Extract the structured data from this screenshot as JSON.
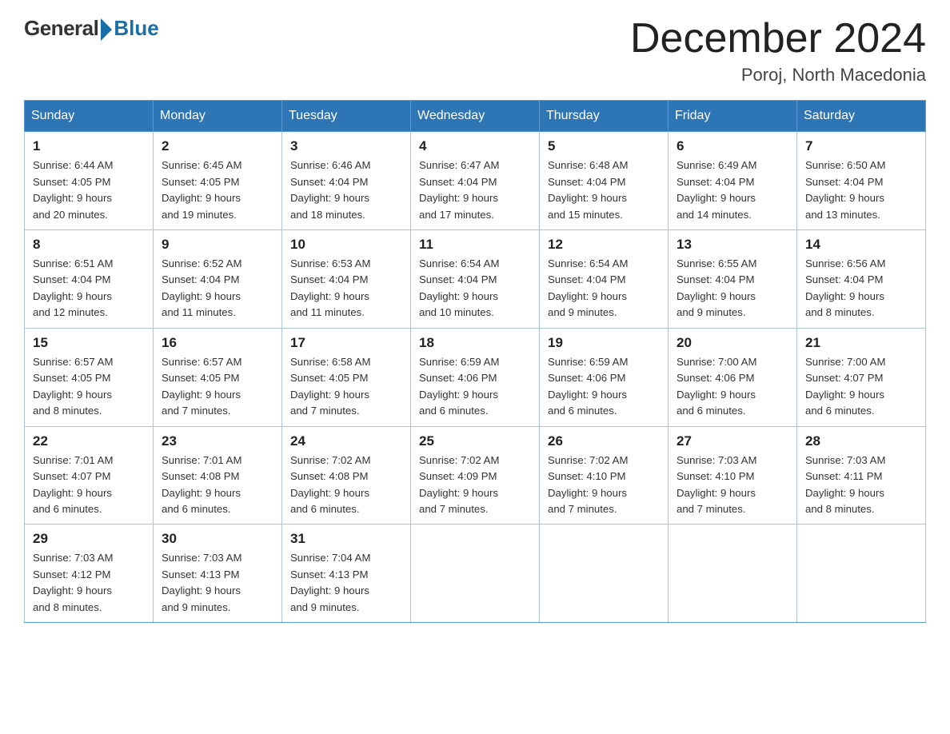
{
  "header": {
    "logo_general": "General",
    "logo_blue": "Blue",
    "month_title": "December 2024",
    "location": "Poroj, North Macedonia"
  },
  "weekdays": [
    "Sunday",
    "Monday",
    "Tuesday",
    "Wednesday",
    "Thursday",
    "Friday",
    "Saturday"
  ],
  "weeks": [
    [
      {
        "day": "1",
        "sunrise": "6:44 AM",
        "sunset": "4:05 PM",
        "daylight": "9 hours and 20 minutes."
      },
      {
        "day": "2",
        "sunrise": "6:45 AM",
        "sunset": "4:05 PM",
        "daylight": "9 hours and 19 minutes."
      },
      {
        "day": "3",
        "sunrise": "6:46 AM",
        "sunset": "4:04 PM",
        "daylight": "9 hours and 18 minutes."
      },
      {
        "day": "4",
        "sunrise": "6:47 AM",
        "sunset": "4:04 PM",
        "daylight": "9 hours and 17 minutes."
      },
      {
        "day": "5",
        "sunrise": "6:48 AM",
        "sunset": "4:04 PM",
        "daylight": "9 hours and 15 minutes."
      },
      {
        "day": "6",
        "sunrise": "6:49 AM",
        "sunset": "4:04 PM",
        "daylight": "9 hours and 14 minutes."
      },
      {
        "day": "7",
        "sunrise": "6:50 AM",
        "sunset": "4:04 PM",
        "daylight": "9 hours and 13 minutes."
      }
    ],
    [
      {
        "day": "8",
        "sunrise": "6:51 AM",
        "sunset": "4:04 PM",
        "daylight": "9 hours and 12 minutes."
      },
      {
        "day": "9",
        "sunrise": "6:52 AM",
        "sunset": "4:04 PM",
        "daylight": "9 hours and 11 minutes."
      },
      {
        "day": "10",
        "sunrise": "6:53 AM",
        "sunset": "4:04 PM",
        "daylight": "9 hours and 11 minutes."
      },
      {
        "day": "11",
        "sunrise": "6:54 AM",
        "sunset": "4:04 PM",
        "daylight": "9 hours and 10 minutes."
      },
      {
        "day": "12",
        "sunrise": "6:54 AM",
        "sunset": "4:04 PM",
        "daylight": "9 hours and 9 minutes."
      },
      {
        "day": "13",
        "sunrise": "6:55 AM",
        "sunset": "4:04 PM",
        "daylight": "9 hours and 9 minutes."
      },
      {
        "day": "14",
        "sunrise": "6:56 AM",
        "sunset": "4:04 PM",
        "daylight": "9 hours and 8 minutes."
      }
    ],
    [
      {
        "day": "15",
        "sunrise": "6:57 AM",
        "sunset": "4:05 PM",
        "daylight": "9 hours and 8 minutes."
      },
      {
        "day": "16",
        "sunrise": "6:57 AM",
        "sunset": "4:05 PM",
        "daylight": "9 hours and 7 minutes."
      },
      {
        "day": "17",
        "sunrise": "6:58 AM",
        "sunset": "4:05 PM",
        "daylight": "9 hours and 7 minutes."
      },
      {
        "day": "18",
        "sunrise": "6:59 AM",
        "sunset": "4:06 PM",
        "daylight": "9 hours and 6 minutes."
      },
      {
        "day": "19",
        "sunrise": "6:59 AM",
        "sunset": "4:06 PM",
        "daylight": "9 hours and 6 minutes."
      },
      {
        "day": "20",
        "sunrise": "7:00 AM",
        "sunset": "4:06 PM",
        "daylight": "9 hours and 6 minutes."
      },
      {
        "day": "21",
        "sunrise": "7:00 AM",
        "sunset": "4:07 PM",
        "daylight": "9 hours and 6 minutes."
      }
    ],
    [
      {
        "day": "22",
        "sunrise": "7:01 AM",
        "sunset": "4:07 PM",
        "daylight": "9 hours and 6 minutes."
      },
      {
        "day": "23",
        "sunrise": "7:01 AM",
        "sunset": "4:08 PM",
        "daylight": "9 hours and 6 minutes."
      },
      {
        "day": "24",
        "sunrise": "7:02 AM",
        "sunset": "4:08 PM",
        "daylight": "9 hours and 6 minutes."
      },
      {
        "day": "25",
        "sunrise": "7:02 AM",
        "sunset": "4:09 PM",
        "daylight": "9 hours and 7 minutes."
      },
      {
        "day": "26",
        "sunrise": "7:02 AM",
        "sunset": "4:10 PM",
        "daylight": "9 hours and 7 minutes."
      },
      {
        "day": "27",
        "sunrise": "7:03 AM",
        "sunset": "4:10 PM",
        "daylight": "9 hours and 7 minutes."
      },
      {
        "day": "28",
        "sunrise": "7:03 AM",
        "sunset": "4:11 PM",
        "daylight": "9 hours and 8 minutes."
      }
    ],
    [
      {
        "day": "29",
        "sunrise": "7:03 AM",
        "sunset": "4:12 PM",
        "daylight": "9 hours and 8 minutes."
      },
      {
        "day": "30",
        "sunrise": "7:03 AM",
        "sunset": "4:13 PM",
        "daylight": "9 hours and 9 minutes."
      },
      {
        "day": "31",
        "sunrise": "7:04 AM",
        "sunset": "4:13 PM",
        "daylight": "9 hours and 9 minutes."
      },
      null,
      null,
      null,
      null
    ]
  ]
}
